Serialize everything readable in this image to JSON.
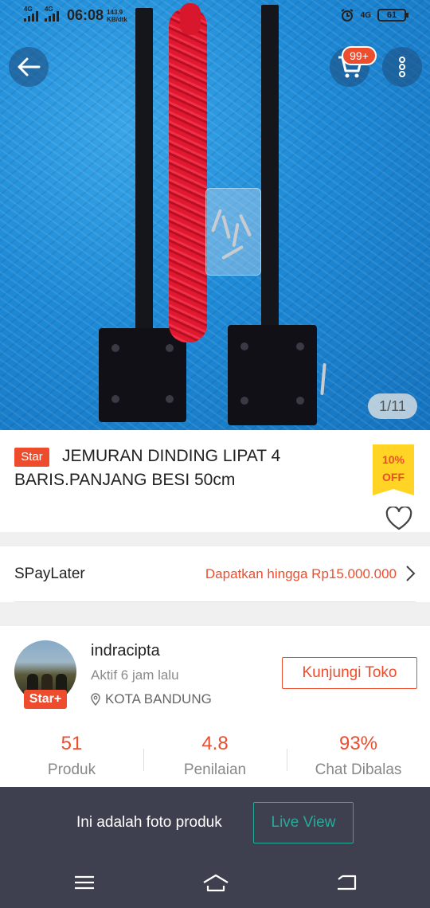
{
  "status_bar": {
    "network_1": "4G",
    "network_2": "4G",
    "time": "06:08",
    "speed_value": "143.9",
    "speed_unit": "KB/dtk",
    "network_3": "4G",
    "battery": "61"
  },
  "product": {
    "image_counter": "1/11",
    "star_badge": "Star",
    "title": "JEMURAN DINDING LIPAT 4 BARIS.PANJANG BESI 50cm",
    "discount_line1": "10%",
    "discount_line2": "OFF"
  },
  "cart": {
    "badge": "99+"
  },
  "spaylater": {
    "label": "SPayLater",
    "offer": "Dapatkan hingga Rp15.000.000"
  },
  "shop": {
    "name": "indracipta",
    "active": "Aktif 6 jam lalu",
    "location": "KOTA BANDUNG",
    "badge": "Star+",
    "visit_label": "Kunjungi Toko",
    "stats": [
      {
        "value": "51",
        "label": "Produk"
      },
      {
        "value": "4.8",
        "label": "Penilaian"
      },
      {
        "value": "93%",
        "label": "Chat Dibalas"
      }
    ]
  },
  "banner": {
    "text": "Ini adalah foto produk",
    "live_label": "Live View"
  },
  "icons": {
    "back": "arrow-left-icon",
    "cart": "cart-icon",
    "more": "kebab-menu-icon",
    "favorite": "heart-icon",
    "location": "location-pin-icon",
    "nav_menu": "menu-icon",
    "nav_home": "home-icon",
    "nav_back": "return-icon"
  },
  "colors": {
    "accent": "#ee4d2d",
    "discount_bg": "#ffd424",
    "live_accent": "#26aa99",
    "banner_bg": "#3e3f4f"
  }
}
